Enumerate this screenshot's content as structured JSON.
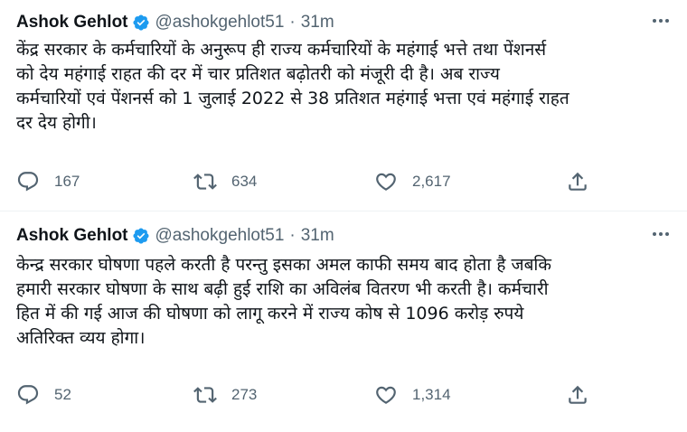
{
  "tweets": [
    {
      "author_name": "Ashok Gehlot",
      "handle": "@ashokgehlot51",
      "separator": "·",
      "time": "31m",
      "text_lines": [
        "केंद्र सरकार के कर्मचारियों के अनुरूप ही राज्य कर्मचारियों के महंगाई भत्ते तथा पेंशनर्स",
        "को देय महंगाई राहत की दर में चार प्रतिशत बढ़ोतरी को मंजूरी दी है। अब राज्य",
        "कर्मचारियों एवं पेंशनर्स को 1 जुलाई 2022 से 38 प्रतिशत महंगाई भत्ता एवं महंगाई राहत",
        "दर देय होगी।"
      ],
      "replies": "167",
      "retweets": "634",
      "likes": "2,617"
    },
    {
      "author_name": "Ashok Gehlot",
      "handle": "@ashokgehlot51",
      "separator": "·",
      "time": "31m",
      "text_lines": [
        "केन्द्र सरकार घोषणा पहले करती है परन्तु इसका अमल काफी समय बाद होता है जबकि",
        "हमारी सरकार घोषणा के साथ बढ़ी हुई राशि का अविलंब वितरण भी करती है। कर्मचारी",
        "हित में की गई आज की घोषणा को लागू करने में राज्य कोष से 1096 करोड़ रुपये",
        "अतिरिक्त व्यय होगा।"
      ],
      "replies": "52",
      "retweets": "273",
      "likes": "1,314"
    }
  ],
  "colors": {
    "text": "#0f1419",
    "secondary": "#536471",
    "verified": "#1d9bf0",
    "divider": "#eff3f4"
  },
  "icons": [
    "verified-badge-icon",
    "more-icon",
    "reply-icon",
    "retweet-icon",
    "like-icon",
    "share-icon"
  ]
}
